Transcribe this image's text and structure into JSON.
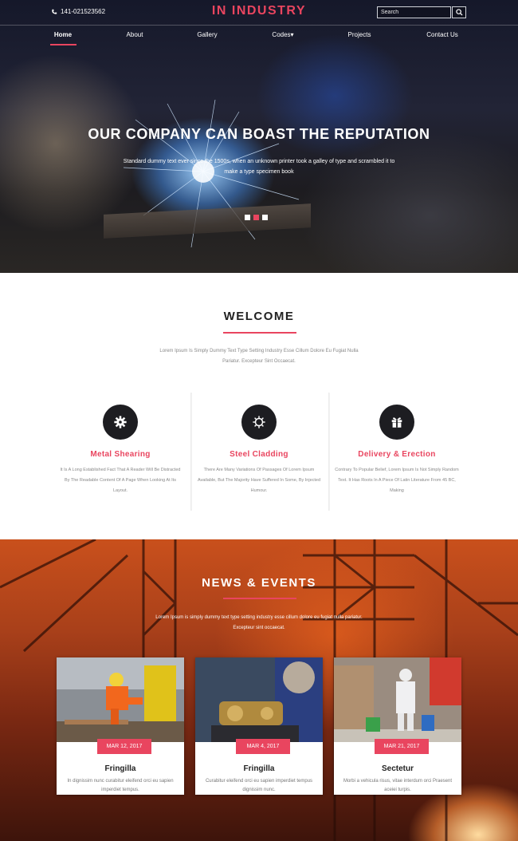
{
  "header": {
    "phone": "141-021523562",
    "logo": "IN INDUSTRY",
    "search_placeholder": "Search"
  },
  "nav": {
    "items": [
      {
        "label": "Home",
        "active": true
      },
      {
        "label": "About"
      },
      {
        "label": "Gallery"
      },
      {
        "label": "Codes▾"
      },
      {
        "label": "Projects"
      },
      {
        "label": "Contact Us"
      }
    ]
  },
  "hero": {
    "title": "OUR COMPANY CAN BOAST THE REPUTATION",
    "subtitle": "Standard dummy text ever since the 1500s, when an unknown printer took a galley of type and scrambled it to make a type specimen book",
    "slides": 3,
    "active_slide": 2
  },
  "welcome": {
    "title": "WELCOME",
    "intro": "Lorem Ipsum Is Simply Dummy Text Type Setting Industry Esse Cillum Dolore Eu Fugiat Nulla Pariatur. Excepteur Sint Occaecat.",
    "features": [
      {
        "icon": "gear-icon",
        "title": "Metal Shearing",
        "desc": "It Is A Long Established Fact That A Reader Will Be Distracted By The Readable Content Of A Page When Looking At Its Layout."
      },
      {
        "icon": "cog-outline-icon",
        "title": "Steel Cladding",
        "desc": "There Are Many Variations Of Passages Of Lorem Ipsum Available, But The Majority Have Suffered In Some, By Injected Humour."
      },
      {
        "icon": "gift-icon",
        "title": "Delivery & Erection",
        "desc": "Contrary To Popular Belief, Lorem Ipsum Is Not Simply Random Text. It Has Roots In A Piece Of Latin Literature From 45 BC, Making"
      }
    ]
  },
  "news": {
    "title": "NEWS & EVENTS",
    "intro": "Lorem Ipsum is simply dummy text type setting industry esse cillum dolore eu fugiat nulla pariatur. Excepteur sint occaecat.",
    "cards": [
      {
        "date": "MAR 12, 2017",
        "title": "Fringilla",
        "desc": "In dignissim nunc curabitur eleifend orci eu sapien imperdiet tempus."
      },
      {
        "date": "MAR 4, 2017",
        "title": "Fringilla",
        "desc": "Curabitur eleifend orci eu sapien imperdiet tempus dignissim nunc."
      },
      {
        "date": "MAR 21, 2017",
        "title": "Sectetur",
        "desc": "Morbi a vehicula risus, vitae interdum orci Praesent aceiei turpis."
      }
    ]
  },
  "colors": {
    "accent": "#e9455f",
    "dark": "#1d1d21"
  }
}
